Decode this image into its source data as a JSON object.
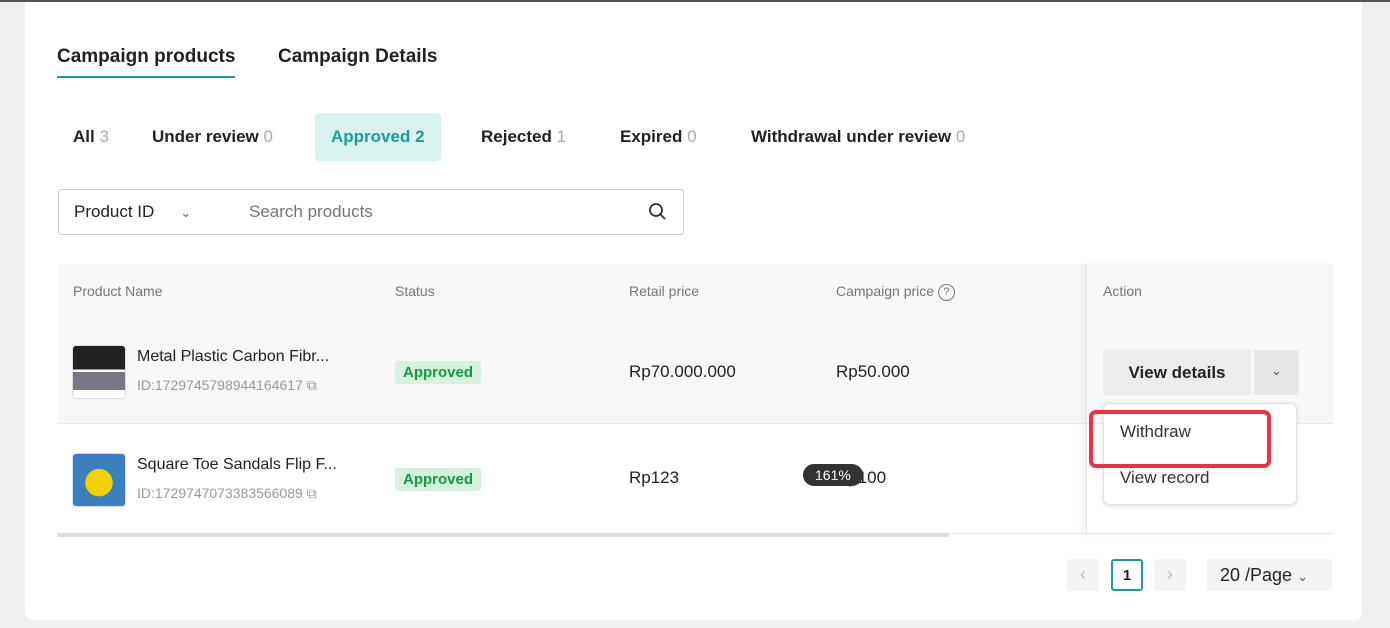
{
  "tabs": [
    {
      "label": "Campaign products",
      "active": true
    },
    {
      "label": "Campaign Details",
      "active": false
    }
  ],
  "filters": [
    {
      "label": "All",
      "count": "3"
    },
    {
      "label": "Under review",
      "count": "0"
    },
    {
      "label": "Approved",
      "count": "2",
      "active": true
    },
    {
      "label": "Rejected",
      "count": "1"
    },
    {
      "label": "Expired",
      "count": "0"
    },
    {
      "label": "Withdrawal under review",
      "count": "0"
    }
  ],
  "search": {
    "field": "Product ID",
    "placeholder": "Search products"
  },
  "table": {
    "columns": [
      "Product Name",
      "Status",
      "Retail price",
      "Campaign price",
      "Action"
    ],
    "rows": [
      {
        "name": "Metal Plastic Carbon Fibr...",
        "id": "ID:1729745798944164617",
        "status": "Approved",
        "retail": "Rp70.000.000",
        "campaign": "Rp50.000"
      },
      {
        "name": "Square Toe Sandals Flip F...",
        "id": "ID:1729747073383566089",
        "status": "Approved",
        "retail": "Rp123",
        "campaign": "Rp100"
      }
    ]
  },
  "action": {
    "view_details": "View details",
    "menu": [
      "Withdraw",
      "View record"
    ]
  },
  "zoom_badge": "161%",
  "pagination": {
    "current": "1",
    "page_size": "20 /Page"
  },
  "colors": {
    "accent": "#1a9e9a",
    "approved": "#139a43",
    "highlight": "#f03040"
  }
}
